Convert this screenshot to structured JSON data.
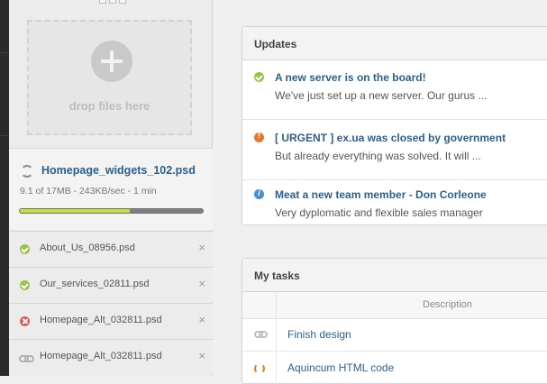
{
  "uploader": {
    "drop_label": "drop files here",
    "current": {
      "name": "Homepage_widgets_102.psd",
      "meta": "9.1 of 17MB - 243KB/sec - 1 min",
      "progress": 0.6
    },
    "files": [
      {
        "name": "About_Us_08956.psd",
        "status": "done",
        "icon": "check-icon"
      },
      {
        "name": "Our_services_02811.psd",
        "status": "done",
        "icon": "check-icon"
      },
      {
        "name": "Homepage_Alt_032811.psd",
        "status": "error",
        "icon": "error-icon"
      },
      {
        "name": "Homepage_Alt_032811.psd",
        "status": "queued",
        "icon": "link-icon"
      }
    ],
    "remove_label": "×"
  },
  "updates": {
    "title": "Updates",
    "items": [
      {
        "title": "A new server is on the board!",
        "text": "We've just set up a new server. Our gurus ...",
        "icon": "check-icon"
      },
      {
        "title": "[ URGENT ] ex.ua was closed by government",
        "text": "But already everything was solved. It will ...",
        "icon": "warning-icon"
      },
      {
        "title": "Meat a new team member - Don Corleone",
        "text": "Very dyplomatic and flexible sales manager",
        "icon": "info-icon"
      }
    ]
  },
  "tasks": {
    "title": "My tasks",
    "column_description": "Description",
    "items": [
      {
        "name": "Finish design",
        "icon": "link-icon"
      },
      {
        "name": "Aquincum HTML code",
        "icon": "refresh-icon"
      }
    ]
  },
  "colors": {
    "link": "#2c5f88",
    "progress": "#bfe33b",
    "ok": "#98c24b",
    "error": "#d95c5c",
    "warning": "#e8762b",
    "info": "#4a90c9"
  }
}
